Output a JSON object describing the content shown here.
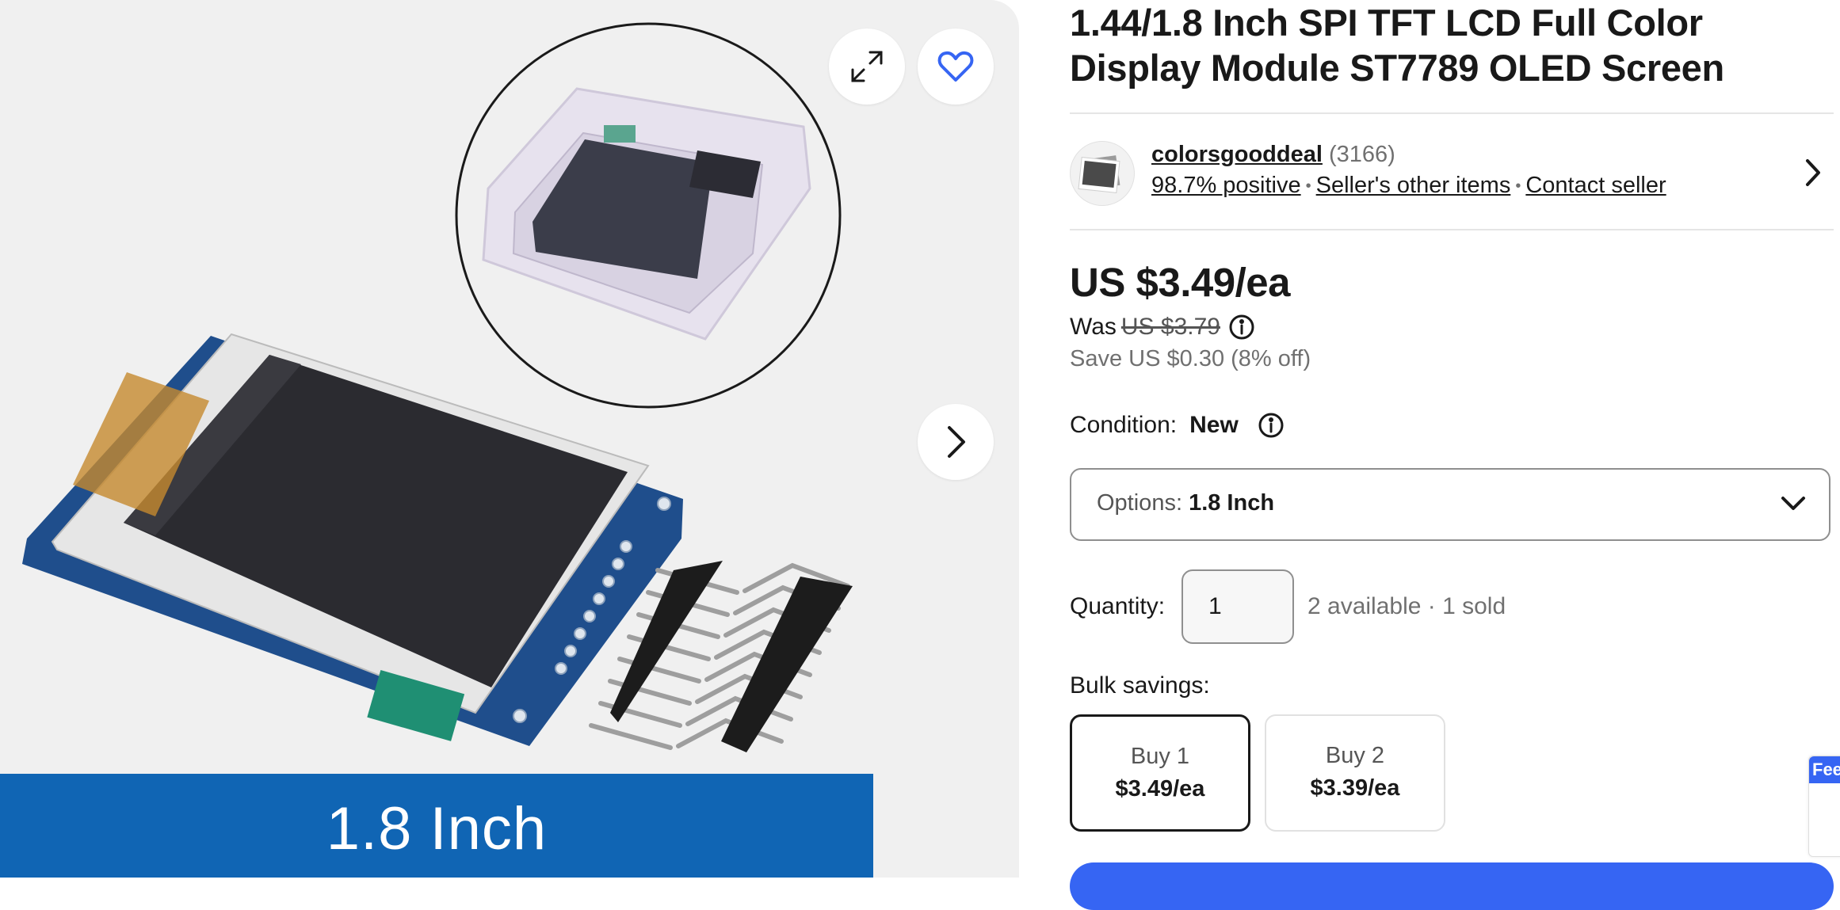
{
  "gallery": {
    "caption": "1.8 Inch",
    "expand_icon": "expand-arrows-icon",
    "favorite_icon": "heart-outline-icon",
    "next_icon": "chevron-right-icon",
    "banner_color": "#1065b4"
  },
  "listing": {
    "title": "1.44/1.8 Inch SPI TFT LCD Full Color Display Module ST7789 OLED Screen"
  },
  "seller": {
    "name": "colorsgooddeal",
    "feedback_count": "(3166)",
    "positive": "98.7% positive",
    "other_items": "Seller's other items",
    "contact": "Contact seller"
  },
  "pricing": {
    "price": "US $3.49/ea",
    "was_label": "Was",
    "was_price": "US $3.79",
    "savings": "Save US $0.30 (8% off)"
  },
  "condition": {
    "label": "Condition:",
    "value": "New"
  },
  "options": {
    "label": "Options:",
    "selected": "1.8 Inch"
  },
  "quantity": {
    "label": "Quantity:",
    "value": "1",
    "availability": "2 available · 1 sold"
  },
  "bulk": {
    "label": "Bulk savings:",
    "tiers": [
      {
        "title": "Buy 1",
        "price": "$3.49/ea",
        "selected": true
      },
      {
        "title": "Buy 2",
        "price": "$3.39/ea",
        "selected": false
      }
    ]
  },
  "feedback_tab": {
    "label": "Fee"
  },
  "colors": {
    "accent_blue": "#3665f3",
    "text": "#191919",
    "muted": "#707070"
  }
}
